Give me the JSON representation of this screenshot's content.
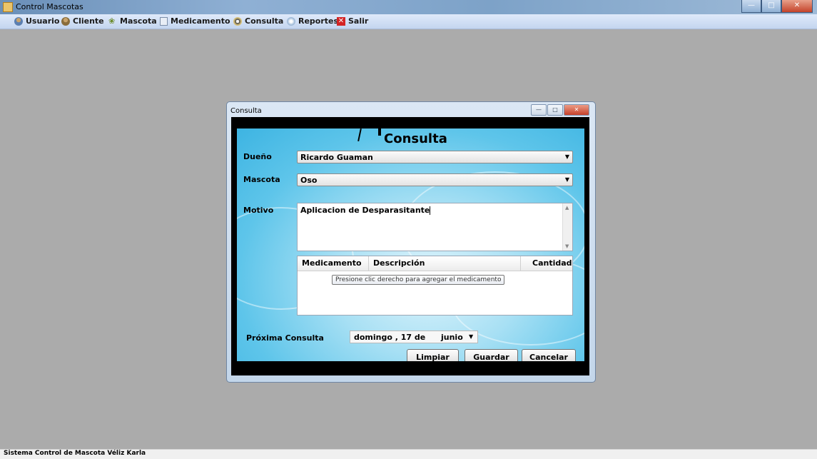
{
  "window": {
    "title": "Control Mascotas"
  },
  "menu": {
    "items": [
      {
        "label": "Usuario",
        "icon": "user-icon"
      },
      {
        "label": "Cliente",
        "icon": "client-icon"
      },
      {
        "label": "Mascota",
        "icon": "pet-icon"
      },
      {
        "label": "Medicamento",
        "icon": "medicine-icon"
      },
      {
        "label": "Consulta",
        "icon": "consult-icon"
      },
      {
        "label": "Reportes",
        "icon": "reports-icon"
      },
      {
        "label": "Salir",
        "icon": "exit-icon"
      }
    ]
  },
  "dialog": {
    "title": "Consulta",
    "heading": "Consulta",
    "owner": {
      "label": "Dueño",
      "value": "Ricardo Guaman"
    },
    "pet": {
      "label": "Mascota",
      "value": "Oso"
    },
    "reason": {
      "label": "Motivo",
      "value": "Aplicacion de Desparasitante"
    },
    "grid": {
      "columns": [
        "Medicamento",
        "Descripción",
        "Cantidad"
      ],
      "tooltip": "Presione clic derecho para agregar el medicamento"
    },
    "next": {
      "label": "Próxima Consulta",
      "date": "domingo , 17 de",
      "month": "junio"
    },
    "buttons": {
      "clear": "Limpiar",
      "save": "Guardar",
      "cancel": "Cancelar"
    }
  },
  "status": {
    "text": "Sistema Control de Mascota  Véliz Karla"
  }
}
